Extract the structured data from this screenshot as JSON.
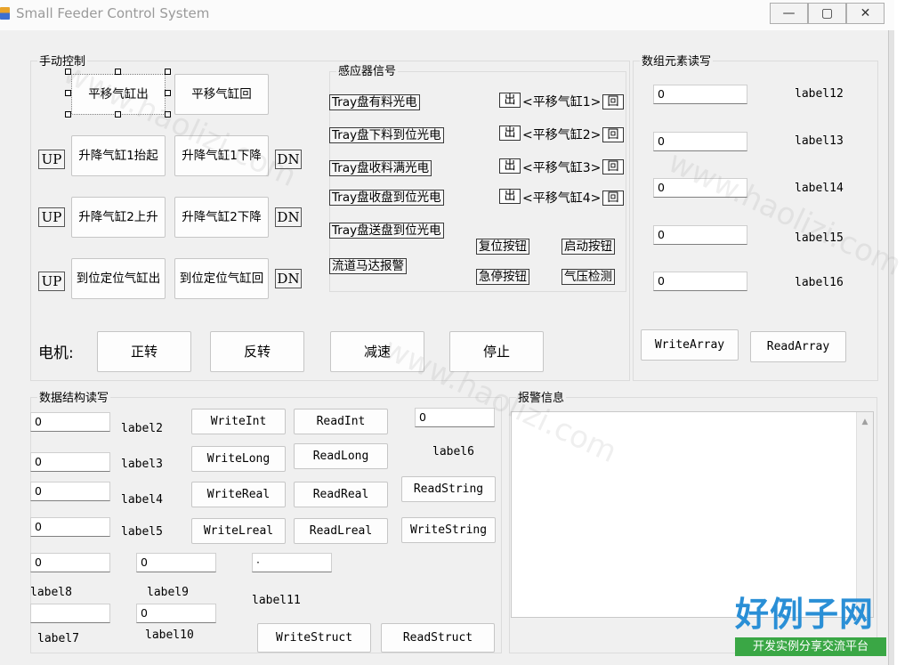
{
  "window": {
    "title": "Small Feeder Control System",
    "minimize": "—",
    "maximize": "▢",
    "close": "✕"
  },
  "manual": {
    "title": "手动控制",
    "btn_translate_out": "平移气缸出",
    "btn_translate_back": "平移气缸回",
    "up": "UP",
    "dn": "DN",
    "btn_lift1_up": "升降气缸1抬起",
    "btn_lift1_down": "升降气缸1下降",
    "btn_lift2_up": "升降气缸2上升",
    "btn_lift2_down": "升降气缸2下降",
    "btn_pos_out": "到位定位气缸出",
    "btn_pos_back": "到位定位气缸回",
    "motor_label": "电机:",
    "motor_forward": "正转",
    "motor_reverse": "反转",
    "motor_slow": "减速",
    "motor_stop": "停止"
  },
  "sensors": {
    "title": "感应器信号",
    "s1": "Tray盘有料光电",
    "s2": "Tray盘下料到位光电",
    "s3": "Tray盘收料满光电",
    "s4": "Tray盘收盘到位光电",
    "s5": "Tray盘送盘到位光电",
    "s6": "流道马达报警",
    "out": "出",
    "back": "回",
    "cyl1": "<平移气缸1>",
    "cyl2": "<平移气缸2>",
    "cyl3": "<平移气缸3>",
    "cyl4": "<平移气缸4>",
    "reset": "复位按钮",
    "start": "启动按钮",
    "estop": "急停按钮",
    "air": "气压检测"
  },
  "array": {
    "title": "数组元素读写",
    "values": [
      "0",
      "0",
      "0",
      "0",
      "0"
    ],
    "labels": [
      "label12",
      "label13",
      "label14",
      "label15",
      "label16"
    ],
    "write": "WriteArray",
    "read": "ReadArray"
  },
  "struct": {
    "title": "数据结构读写",
    "v_int": "0",
    "v_long": "0",
    "v_real": "0",
    "v_lreal": "0",
    "v_string": "0",
    "label2": "label2",
    "label3": "label3",
    "label4": "label4",
    "label5": "label5",
    "label6": "label6",
    "write_int": "WriteInt",
    "read_int": "ReadInt",
    "write_long": "WriteLong",
    "read_long": "ReadLong",
    "write_real": "WriteReal",
    "read_real": "ReadReal",
    "write_lreal": "WriteLreal",
    "read_lreal": "ReadLreal",
    "read_string": "ReadString",
    "write_string": "WriteString",
    "f1": "0",
    "f2": "0",
    "f3": "·",
    "f4": "",
    "f5": "0",
    "label7": "label7",
    "label8": "label8",
    "label9": "label9",
    "label10": "label10",
    "label11": "label11",
    "write_struct": "WriteStruct",
    "read_struct": "ReadStruct"
  },
  "alarm": {
    "title": "报警信息",
    "scroll_up": "▲"
  },
  "watermark": {
    "logo": "好例子网",
    "slogan": "开发实例分享交流平台",
    "url": "www.haolizi.com"
  },
  "colors": {
    "logo_blue": "#2a8fd6",
    "logo_green": "#3aa745"
  }
}
